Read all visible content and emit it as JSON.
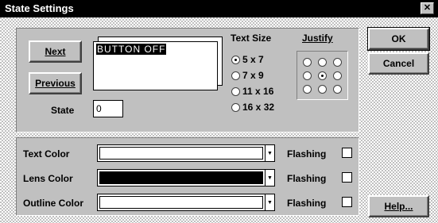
{
  "window": {
    "title": "State Settings"
  },
  "buttons": {
    "next": "Next",
    "previous": "Previous",
    "ok": "OK",
    "cancel": "Cancel",
    "help": "Help..."
  },
  "preview": {
    "text": "BUTTON OFF"
  },
  "state": {
    "label": "State",
    "value": "0"
  },
  "text_size": {
    "label": "Text Size",
    "options": [
      "5 x 7",
      "7 x 9",
      "11 x 16",
      "16 x 32"
    ],
    "selected": "5 x 7"
  },
  "justify": {
    "label": "Justify",
    "selected": "center"
  },
  "colors": {
    "text_color": {
      "label": "Text Color",
      "value": "#ffffff",
      "flashing_label": "Flashing",
      "flashing": false
    },
    "lens_color": {
      "label": "Lens Color",
      "value": "#000000",
      "flashing_label": "Flashing",
      "flashing": false
    },
    "outline_color": {
      "label": "Outline Color",
      "value": "#ffffff",
      "flashing_label": "Flashing",
      "flashing": false
    }
  },
  "icons": {
    "close": "close-icon",
    "dropdown": "chevron-down-icon"
  }
}
